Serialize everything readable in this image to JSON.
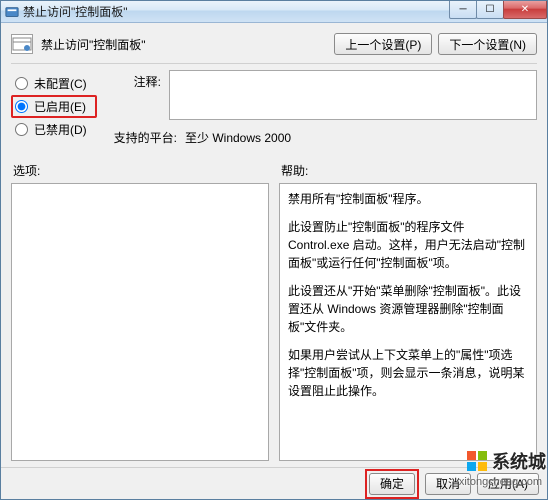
{
  "title": "禁止访问\"控制面板\"",
  "header": {
    "text": "禁止访问\"控制面板\"",
    "prev_btn": "上一个设置(P)",
    "next_btn": "下一个设置(N)"
  },
  "radios": {
    "not_configured": "未配置(C)",
    "enabled": "已启用(E)",
    "disabled": "已禁用(D)"
  },
  "fields": {
    "comment_label": "注释:",
    "comment_value": "",
    "platform_label": "支持的平台:",
    "platform_value": "至少 Windows 2000"
  },
  "panels": {
    "options_label": "选项:",
    "help_label": "帮助:",
    "help_p1": "禁用所有\"控制面板\"程序。",
    "help_p2": "此设置防止\"控制面板\"的程序文件 Control.exe 启动。这样，用户无法启动\"控制面板\"或运行任何\"控制面板\"项。",
    "help_p3": "此设置还从\"开始\"菜单删除\"控制面板\"。此设置还从 Windows 资源管理器删除\"控制面板\"文件夹。",
    "help_p4": "如果用户尝试从上下文菜单上的\"属性\"项选择\"控制面板\"项，则会显示一条消息，说明某设置阻止此操作。"
  },
  "buttons": {
    "ok": "确定",
    "cancel": "取消",
    "apply": "应用(A)"
  },
  "watermark": {
    "text": "系统城",
    "url": "xitongcheng.com"
  }
}
